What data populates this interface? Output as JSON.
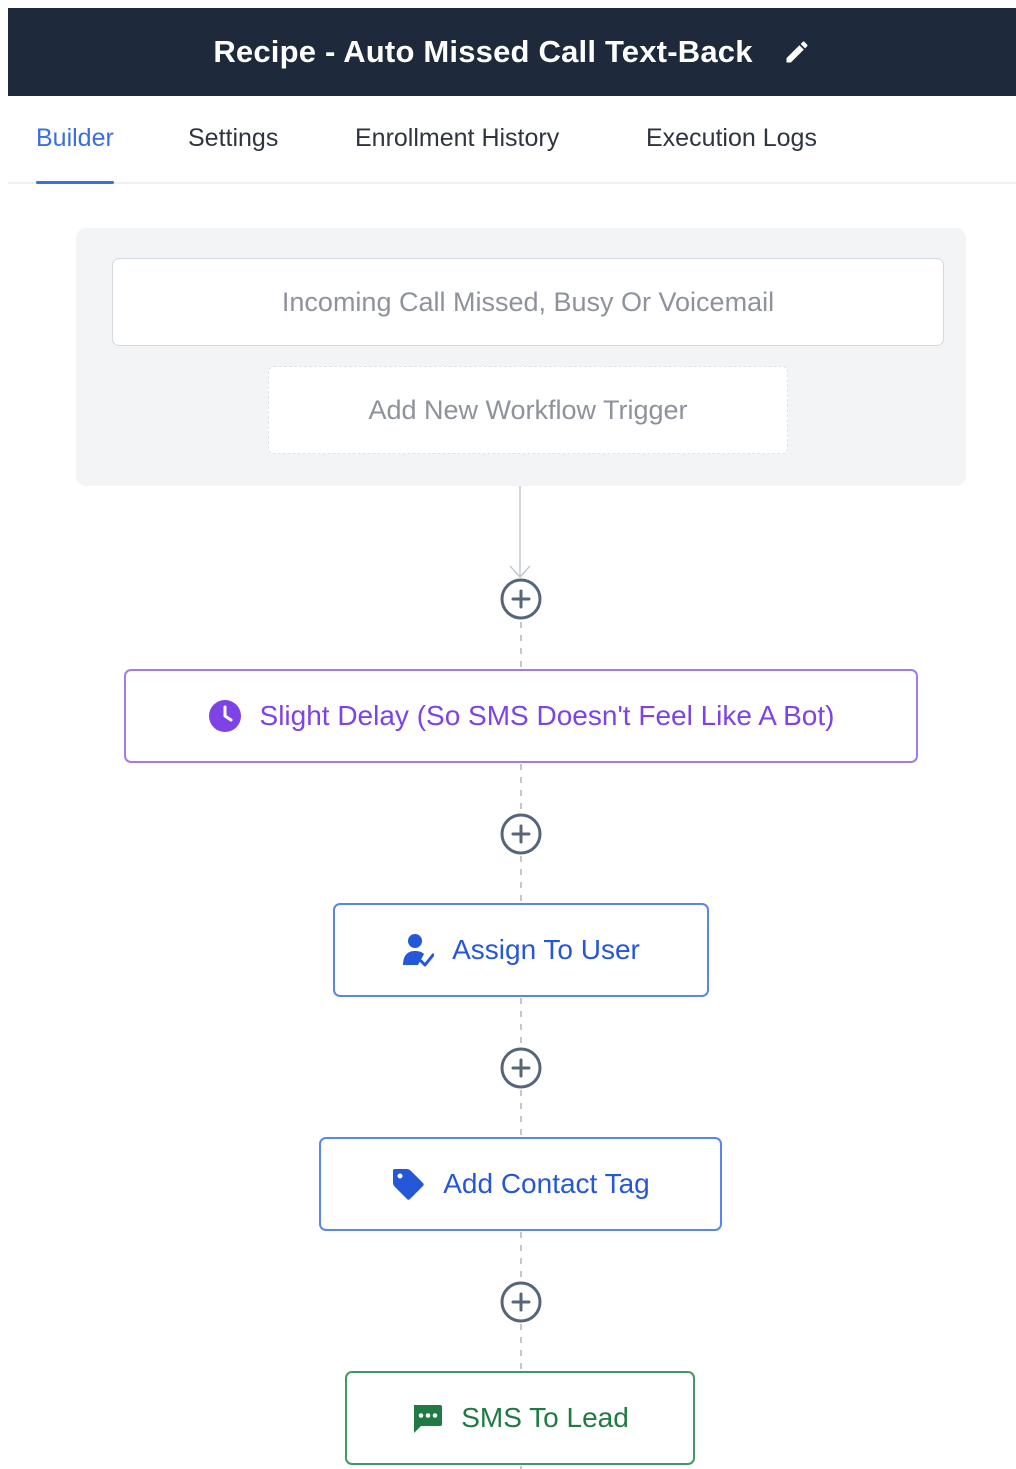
{
  "header": {
    "title": "Recipe - Auto Missed Call Text-Back",
    "edit_icon": "pencil-icon"
  },
  "tabs": [
    {
      "label": "Builder",
      "active": true
    },
    {
      "label": "Settings",
      "active": false
    },
    {
      "label": "Enrollment History",
      "active": false
    },
    {
      "label": "Execution Logs",
      "active": false
    }
  ],
  "triggers": {
    "items": [
      "Incoming Call Missed, Busy Or Voicemail"
    ],
    "add_label": "Add New Workflow Trigger"
  },
  "actions": [
    {
      "label": "Slight Delay (So SMS Doesn't Feel Like A Bot)",
      "icon": "clock-icon",
      "color": "#7e43e6"
    },
    {
      "label": "Assign To User",
      "icon": "user-assign-icon",
      "color": "#2557d9"
    },
    {
      "label": "Add Contact Tag",
      "icon": "tag-icon",
      "color": "#2557d9"
    },
    {
      "label": "SMS To Lead",
      "icon": "sms-icon",
      "color": "#1f7a43"
    }
  ],
  "add_step_icon": "plus-circle-icon",
  "colors": {
    "header_bg": "#1e2a3b",
    "active_tab": "#3a6fe0",
    "connector": "#b9c0ca",
    "plus_icon": "#56657a"
  }
}
